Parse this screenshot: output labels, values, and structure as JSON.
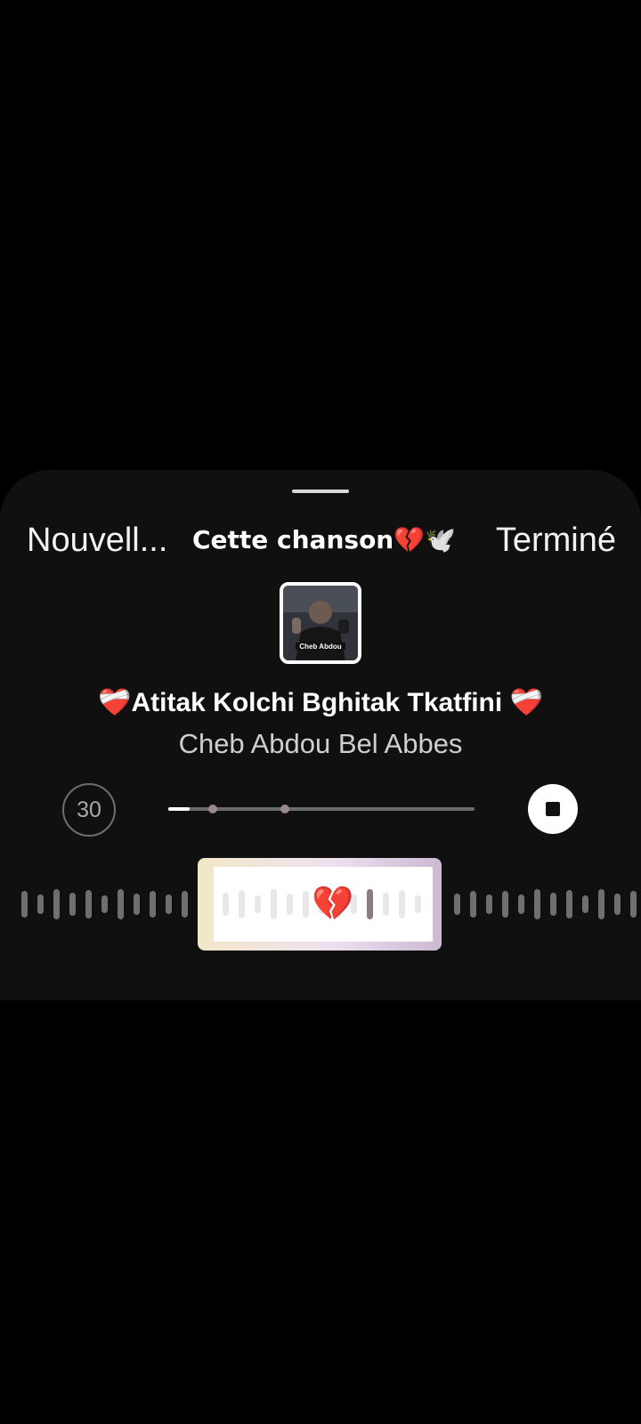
{
  "sheet": {
    "nav": {
      "left_label": "Nouvell...",
      "center_label": "Cette chanson💔🕊️",
      "right_label": "Terminé"
    },
    "cover": {
      "caption": "Cheb Abdou"
    },
    "track": {
      "title": "❤️‍🩹Atitak Kolchi Bghitak Tkatfini ❤️‍🩹",
      "artist": "Cheb Abdou Bel Abbes"
    },
    "player": {
      "duration_label": "30",
      "progress_fraction": 0.07,
      "marker_fractions": [
        0.145,
        0.38
      ]
    },
    "selector": {
      "emoji": "💔"
    },
    "colors": {
      "background": "#000000",
      "sheet": "#101010",
      "text_primary": "#ffffff",
      "text_secondary": "#cfcfcf"
    },
    "icons": {
      "stop": "stop-icon",
      "duration": "duration-30-icon"
    }
  }
}
